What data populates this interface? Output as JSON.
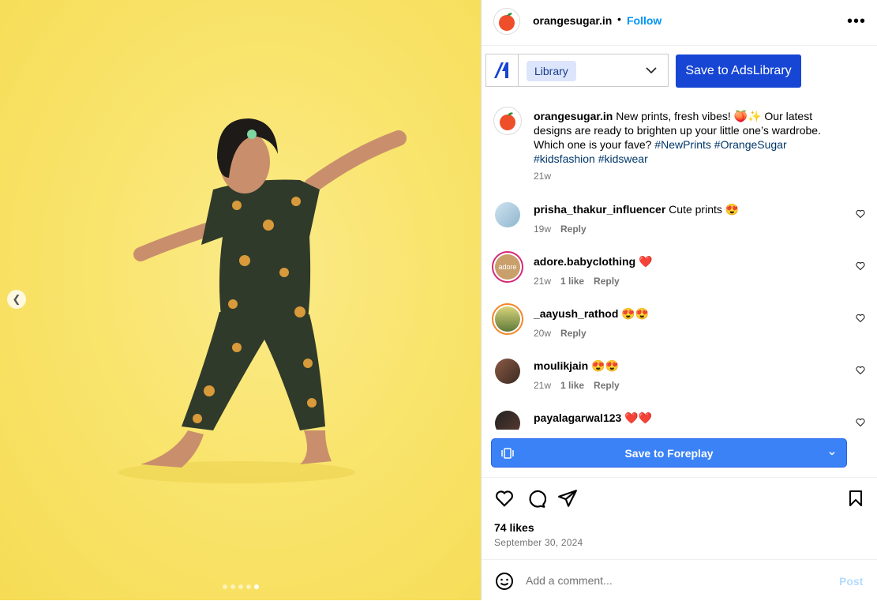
{
  "post": {
    "username": "orangesugar.in",
    "separator": "•",
    "follow_label": "Follow",
    "more_label": "•••"
  },
  "adslibrary": {
    "library_label": "Library",
    "save_label": "Save to AdsLibrary"
  },
  "caption": {
    "username": "orangesugar.in",
    "text": "New prints, fresh vibes! 🍑✨ Our latest designs are ready to brighten up your little one’s wardrobe. Which one is your fave?",
    "hashtags": [
      "#NewPrints",
      "#OrangeSugar",
      "#kidsfashion",
      "#kidswear"
    ],
    "age": "21w"
  },
  "comments": [
    {
      "username": "prisha_thakur_influencer",
      "text": "Cute prints 😍",
      "age": "19w",
      "likes": "",
      "reply": "Reply"
    },
    {
      "username": "adore.babyclothing",
      "text": "❤️",
      "age": "21w",
      "likes": "1 like",
      "reply": "Reply",
      "avatar_text": "adore"
    },
    {
      "username": "_aayush_rathod",
      "text": "😍😍",
      "age": "20w",
      "likes": "",
      "reply": "Reply"
    },
    {
      "username": "moulikjain",
      "text": "😍😍",
      "age": "21w",
      "likes": "1 like",
      "reply": "Reply"
    },
    {
      "username": "payalagarwal123",
      "text": "❤️❤️",
      "age": "",
      "likes": "",
      "reply": ""
    }
  ],
  "foreplay": {
    "label": "Save to Foreplay"
  },
  "stats": {
    "likes": "74 likes",
    "date": "September 30, 2024"
  },
  "add_comment": {
    "placeholder": "Add a comment...",
    "post_label": "Post"
  },
  "carousel": {
    "total": 5,
    "active_index": 4
  },
  "icons": [
    "chevron-left-icon",
    "more-icon",
    "chevron-down-icon",
    "heart-icon",
    "comment-icon",
    "share-icon",
    "bookmark-icon",
    "emoji-icon",
    "foreplay-icon"
  ],
  "colors": {
    "accent": "#0095f6",
    "ads_button": "#1646d3",
    "foreplay_button": "#3b82f6",
    "library_pill": "#dce5fb",
    "hashtag": "#00376b",
    "media_bg": "#f9e46d"
  }
}
